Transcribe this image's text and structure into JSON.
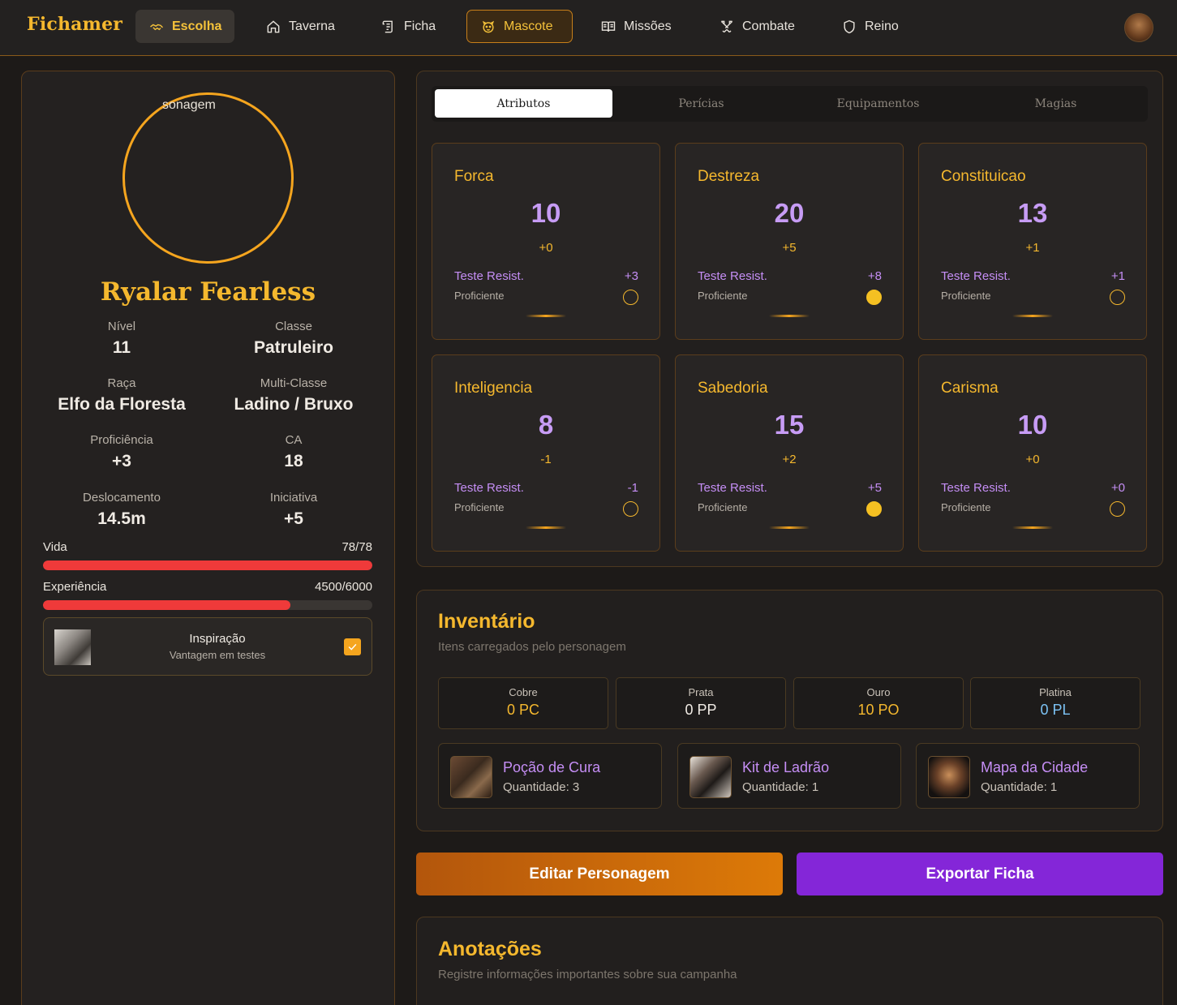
{
  "app": {
    "brand": "Fichamer"
  },
  "nav": {
    "items": [
      {
        "label": "Escolha",
        "icon": "handshake-icon",
        "state": "active"
      },
      {
        "label": "Taverna",
        "icon": "home-icon",
        "state": "normal"
      },
      {
        "label": "Ficha",
        "icon": "scroll-icon",
        "state": "normal"
      },
      {
        "label": "Mascote",
        "icon": "paw-icon",
        "state": "highlighted"
      },
      {
        "label": "Missões",
        "icon": "book-icon",
        "state": "normal"
      },
      {
        "label": "Combate",
        "icon": "swords-icon",
        "state": "normal"
      },
      {
        "label": "Reino",
        "icon": "shield-icon",
        "state": "normal"
      }
    ],
    "user_avatar": "user-avatar"
  },
  "character": {
    "portrait_alt": "sonagem",
    "name": "Ryalar Fearless",
    "stats": {
      "nivel": {
        "label": "Nível",
        "value": "11"
      },
      "classe": {
        "label": "Classe",
        "value": "Patruleiro"
      },
      "raca": {
        "label": "Raça",
        "value": "Elfo da Floresta"
      },
      "multiclasse": {
        "label": "Multi-Classe",
        "value": "Ladino / Bruxo"
      },
      "proficiencia": {
        "label": "Proficiência",
        "value": "+3"
      },
      "ca": {
        "label": "CA",
        "value": "18"
      },
      "deslocamento": {
        "label": "Deslocamento",
        "value": "14.5m"
      },
      "iniciativa": {
        "label": "Iniciativa",
        "value": "+5"
      }
    },
    "vida": {
      "label": "Vida",
      "value": "78/78",
      "fraction": 1.0
    },
    "experiencia": {
      "label": "Experiência",
      "value": "4500/6000",
      "fraction": 0.75
    },
    "inspiracao": {
      "title": "Inspiração",
      "subtitle": "Vantagem em testes",
      "checked": true
    }
  },
  "tabs": [
    "Atributos",
    "Perícias",
    "Equipamentos",
    "Magias"
  ],
  "active_tab": "Atributos",
  "attributes": [
    {
      "name": "Forca",
      "value": "10",
      "mod": "+0",
      "save_label": "Teste Resist.",
      "save": "+3",
      "prof_label": "Proficiente",
      "proficient": false
    },
    {
      "name": "Destreza",
      "value": "20",
      "mod": "+5",
      "save_label": "Teste Resist.",
      "save": "+8",
      "prof_label": "Proficiente",
      "proficient": true
    },
    {
      "name": "Constituicao",
      "value": "13",
      "mod": "+1",
      "save_label": "Teste Resist.",
      "save": "+1",
      "prof_label": "Proficiente",
      "proficient": false
    },
    {
      "name": "Inteligencia",
      "value": "8",
      "mod": "-1",
      "save_label": "Teste Resist.",
      "save": "-1",
      "prof_label": "Proficiente",
      "proficient": false
    },
    {
      "name": "Sabedoria",
      "value": "15",
      "mod": "+2",
      "save_label": "Teste Resist.",
      "save": "+5",
      "prof_label": "Proficiente",
      "proficient": true
    },
    {
      "name": "Carisma",
      "value": "10",
      "mod": "+0",
      "save_label": "Teste Resist.",
      "save": "+0",
      "prof_label": "Proficiente",
      "proficient": false
    }
  ],
  "inventory": {
    "title": "Inventário",
    "subtitle": "Itens carregados pelo personagem",
    "coins": [
      {
        "label": "Cobre",
        "value": "0 PC",
        "color": "#f5b82e"
      },
      {
        "label": "Prata",
        "value": "0 PP",
        "color": "#f0ebe4"
      },
      {
        "label": "Ouro",
        "value": "10 PO",
        "color": "#f5b82e"
      },
      {
        "label": "Platina",
        "value": "0 PL",
        "color": "#7cc3f5"
      }
    ],
    "items": [
      {
        "name": "Poção de Cura",
        "quantity": "Quantidade: 3"
      },
      {
        "name": "Kit de Ladrão",
        "quantity": "Quantidade: 1"
      },
      {
        "name": "Mapa da Cidade",
        "quantity": "Quantidade: 1"
      }
    ]
  },
  "actions": {
    "edit": "Editar Personagem",
    "export": "Exportar Ficha"
  },
  "notes": {
    "title": "Anotações",
    "subtitle": "Registre informações importantes sobre sua campanha"
  },
  "colors": {
    "accent": "#f5b82e",
    "purple": "#c58ef5",
    "health": "#ef3a3a",
    "export": "#8426d8"
  }
}
